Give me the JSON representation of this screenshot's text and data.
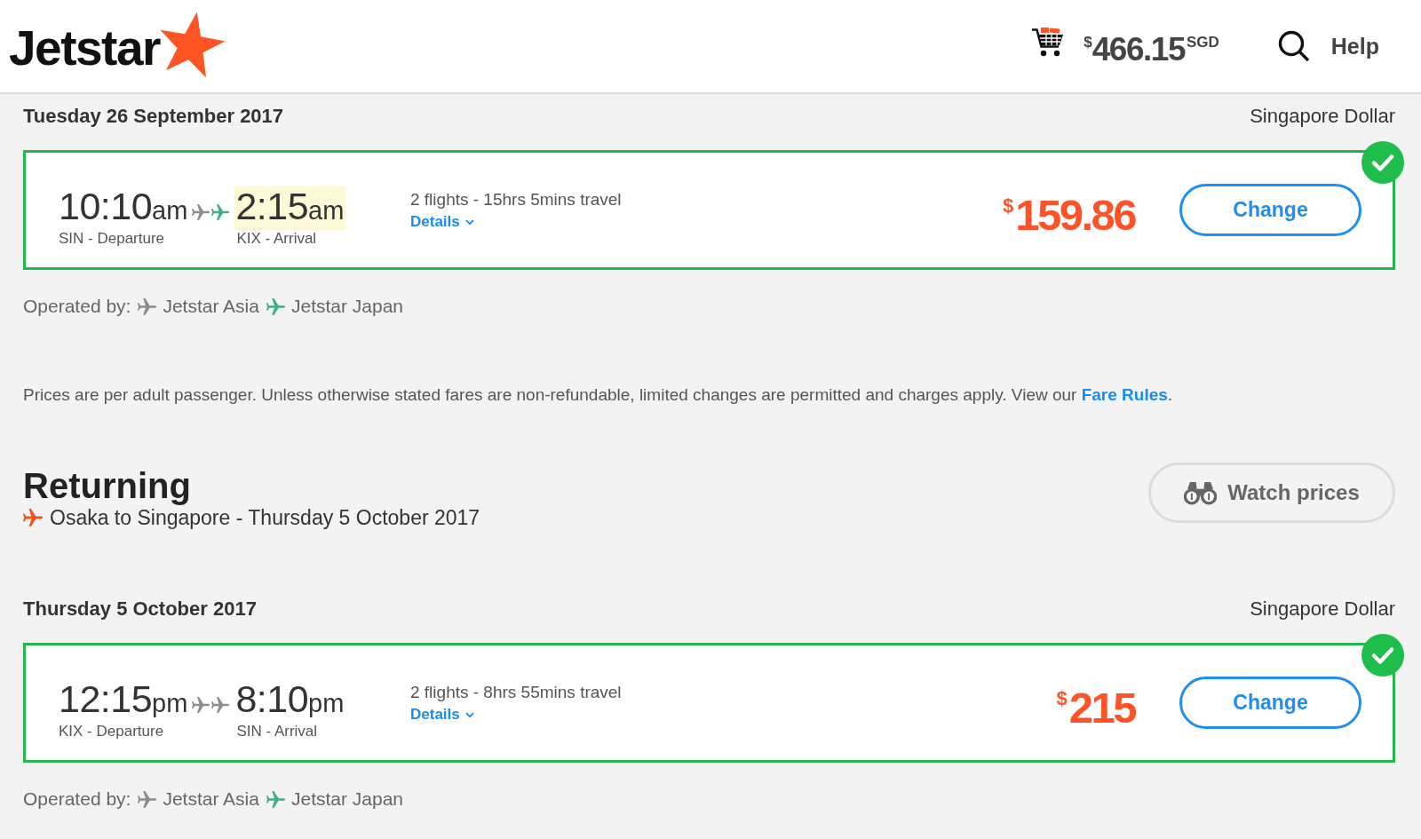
{
  "header": {
    "logo": "Jetstar",
    "cart_total": {
      "symbol": "$",
      "amount": "466.15",
      "currency": "SGD"
    },
    "help": "Help"
  },
  "journeys": [
    {
      "date": "Tuesday 26 September 2017",
      "currency": "Singapore Dollar",
      "flight": {
        "selected": true,
        "departure": {
          "time": "10:10",
          "period": "am",
          "label": "SIN - Departure"
        },
        "legs": [
          {
            "color": "#8c8c8c"
          },
          {
            "color": "#3daf8a"
          }
        ],
        "arrival": {
          "time": "2:15",
          "period": "am",
          "label": "KIX - Arrival",
          "highlighted": true
        },
        "summary": "2 flights - 15hrs 5mins travel",
        "details": "Details",
        "price": {
          "symbol": "$",
          "amount": "159.86"
        },
        "button": "Change"
      },
      "operated_by": {
        "label": "Operated by:",
        "carriers": [
          {
            "name": "Jetstar Asia",
            "color": "#8c8c8c"
          },
          {
            "name": "Jetstar Japan",
            "color": "#3daf8a"
          }
        ]
      },
      "fare_note": {
        "text": "Prices are per adult passenger. Unless otherwise stated fares are non-refundable, limited changes are permitted and charges apply. View our",
        "link": "Fare Rules",
        "after_link": "."
      }
    },
    {
      "heading": {
        "title": "Returning",
        "route": "Osaka to Singapore - Thursday 5 October 2017",
        "watch_button": "Watch prices"
      },
      "date": "Thursday 5 October 2017",
      "currency": "Singapore Dollar",
      "flight": {
        "selected": true,
        "departure": {
          "time": "12:15",
          "period": "pm",
          "label": "KIX - Departure"
        },
        "legs": [
          {
            "color": "#8c8c8c"
          },
          {
            "color": "#8c8c8c"
          }
        ],
        "arrival": {
          "time": "8:10",
          "period": "pm",
          "label": "SIN - Arrival",
          "highlighted": false
        },
        "summary": "2 flights - 8hrs 55mins travel",
        "details": "Details",
        "price": {
          "symbol": "$",
          "amount": "215"
        },
        "button": "Change"
      },
      "operated_by": {
        "label": "Operated by:",
        "carriers": [
          {
            "name": "Jetstar Asia",
            "color": "#8c8c8c"
          },
          {
            "name": "Jetstar Japan",
            "color": "#3daf8a"
          }
        ]
      }
    }
  ]
}
